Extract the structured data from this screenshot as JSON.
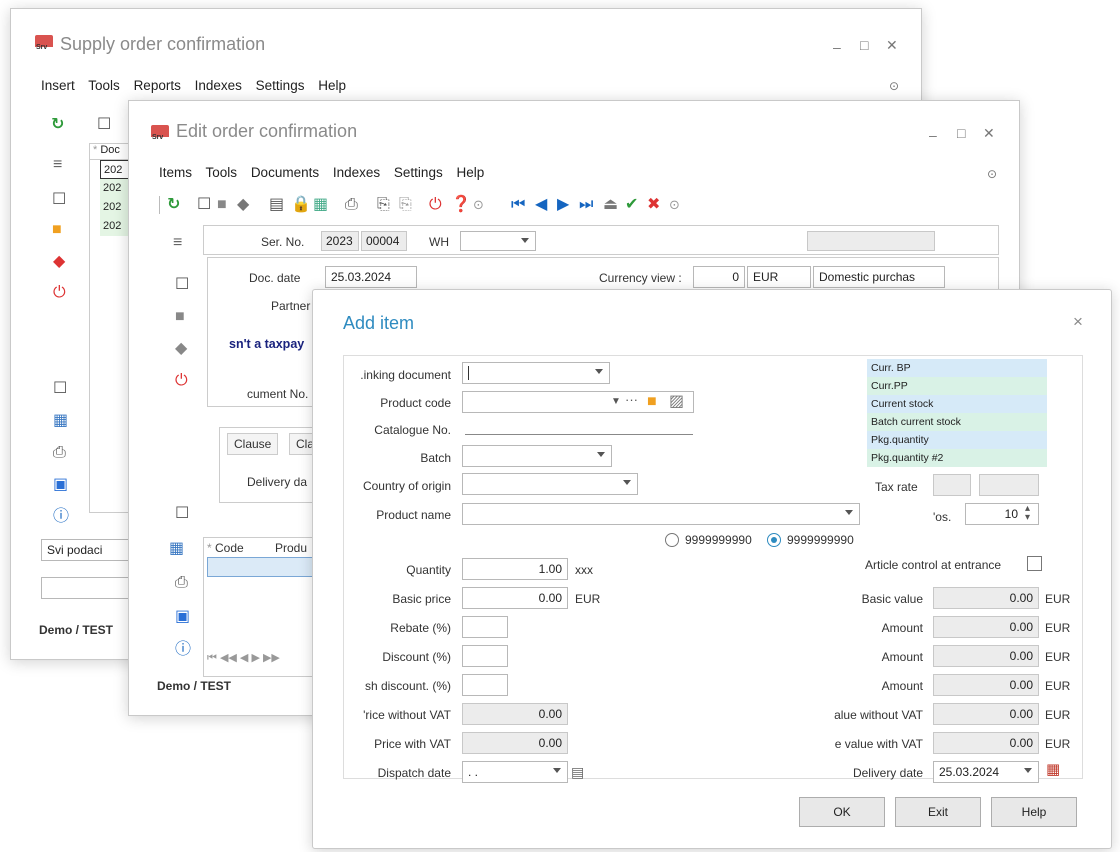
{
  "back_window": {
    "title": "Supply order confirmation",
    "menu": [
      "Insert",
      "Tools",
      "Reports",
      "Indexes",
      "Settings",
      "Help"
    ],
    "grid_header": "Doc",
    "grid_rows": [
      "202",
      "202",
      "202",
      "202"
    ],
    "filter_value": "Svi podaci",
    "status": "Demo / TEST"
  },
  "mid_window": {
    "title": "Edit order confirmation",
    "menu": [
      "Items",
      "Tools",
      "Documents",
      "Indexes",
      "Settings",
      "Help"
    ],
    "ser_no_label": "Ser. No.",
    "ser_no_year": "2023",
    "ser_no_number": "00004",
    "wh_label": "WH",
    "doc_date_label": "Doc. date",
    "doc_date_value": "25.03.2024",
    "currency_view_label": "Currency view :",
    "currency_view_amount": "0",
    "currency_view_code": "EUR",
    "purchase_type": "Domestic purchas",
    "partner_label": "Partner",
    "taxpayer_text": "sn't a taxpay",
    "document_no_label": "cument No.",
    "tab_clause": "Clause",
    "tab_clau": "Clau",
    "delivery_label": "Delivery da",
    "grid_col_code": "Code",
    "grid_col_product": "Produ",
    "status": "Demo / TEST"
  },
  "dialog": {
    "title": "Add item",
    "close": "×",
    "linking_document": ".inking document",
    "product_code": "Product code",
    "catalogue_no": "Catalogue No.",
    "batch": "Batch",
    "country_of_origin": "Country of origin",
    "product_name": "Product name",
    "info_lines": [
      "Curr. BP",
      "Curr.PP",
      "Current stock",
      "Batch current stock",
      "Pkg.quantity",
      "Pkg.quantity #2"
    ],
    "tax_rate": "Tax rate",
    "pos_label": "'os.",
    "pos_value": "10",
    "radio_1": "9999999990",
    "radio_2": "9999999990",
    "quantity_label": "Quantity",
    "quantity_value": "1.00",
    "quantity_unit": "xxx",
    "article_control": "Article control at entrance",
    "basic_price_label": "Basic price",
    "basic_price_value": "0.00",
    "basic_price_unit": "EUR",
    "basic_value_label": "Basic value",
    "basic_value_value": "0.00",
    "basic_value_unit": "EUR",
    "rebate_label": "Rebate (%)",
    "rebate_amount_label": "Amount",
    "rebate_amount_value": "0.00",
    "rebate_amount_unit": "EUR",
    "discount_label": "Discount (%)",
    "discount_amount_label": "Amount",
    "discount_amount_value": "0.00",
    "discount_amount_unit": "EUR",
    "cash_discount_label": "sh discount. (%)",
    "cash_amount_label": "Amount",
    "cash_amount_value": "0.00",
    "cash_amount_unit": "EUR",
    "price_wo_vat_label": "'rice without VAT",
    "price_wo_vat_value": "0.00",
    "value_wo_vat_label": "alue without VAT",
    "value_wo_vat_value": "0.00",
    "value_wo_vat_unit": "EUR",
    "price_w_vat_label": "Price with VAT",
    "price_w_vat_value": "0.00",
    "value_w_vat_label": "e value with VAT",
    "value_w_vat_value": "0.00",
    "value_w_vat_unit": "EUR",
    "dispatch_date_label": "Dispatch date",
    "dispatch_date_value": ". .",
    "delivery_date_label": "Delivery date",
    "delivery_date_value": "25.03.2024",
    "ok": "OK",
    "exit": "Exit",
    "help": "Help"
  },
  "colors": {
    "info_green": "#d9f2e6",
    "info_blue": "#d6eaf8",
    "dialog_title": "#2e8bc0",
    "taxpayer": "#1a237e"
  }
}
